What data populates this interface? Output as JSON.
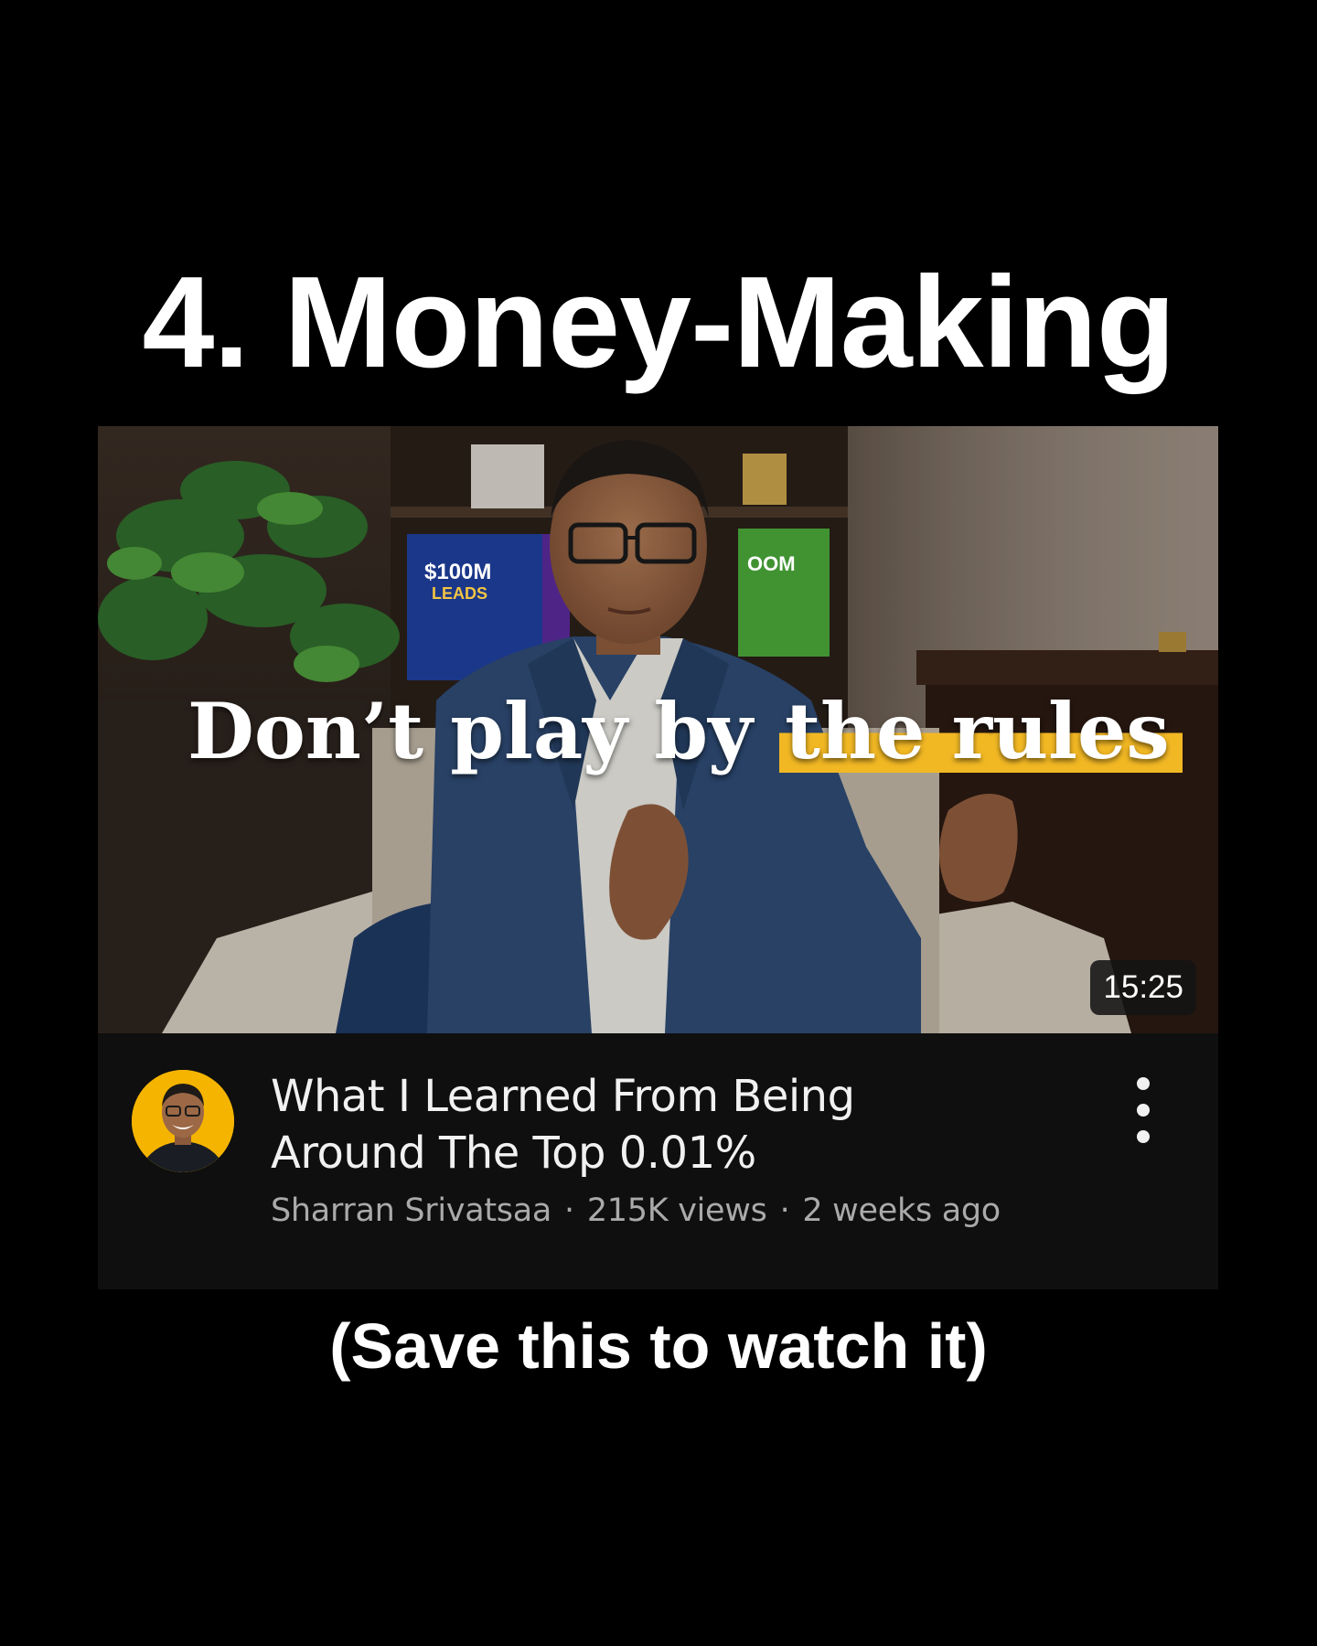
{
  "headline": "4. Money-Making",
  "video": {
    "thumbnail_caption_plain": "Don’t play by ",
    "thumbnail_caption_highlight": "the rules",
    "book_left_title": "$100M",
    "book_left_subtitle": "LEADS",
    "book_right_title": "OOM",
    "duration": "15:25",
    "title": "What I Learned From Being Around The Top 0.01%",
    "channel": "Sharran Srivatsaa",
    "views": "215K views",
    "published": "2 weeks ago",
    "separator": "·",
    "menu_icon": "more-vert-icon"
  },
  "footer": "(Save this to watch it)",
  "colors": {
    "background": "#000000",
    "card_background": "#0f0f0f",
    "highlight": "#f2b824",
    "avatar_bg": "#f5b400"
  }
}
